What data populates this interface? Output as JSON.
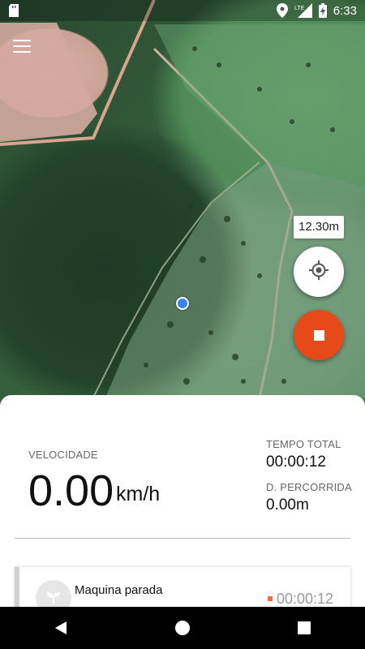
{
  "status_bar": {
    "network": "LTE",
    "time": "6:33"
  },
  "map": {
    "accuracy_label": "12.30m"
  },
  "stats": {
    "speed_label": "VELOCIDADE",
    "speed_value": "0.00",
    "speed_unit": "km/h",
    "total_time_label": "TEMPO TOTAL",
    "total_time_value": "00:00:12",
    "distance_label": "D. PERCORRIDA",
    "distance_value": "0.00m"
  },
  "events": [
    {
      "title": "Maquina parada",
      "time": "00:00:12"
    }
  ],
  "icons": {
    "sd_card": "sd-card-icon",
    "location": "location-icon",
    "signal": "signal-icon",
    "battery": "battery-charging-icon",
    "menu": "menu-icon",
    "locate": "gps-fixed-icon",
    "stop": "stop-icon",
    "plant": "sprout-icon",
    "back": "back-triangle-icon",
    "home": "home-circle-icon",
    "recents": "recents-square-icon"
  },
  "colors": {
    "stop_fab": "#e64a19",
    "position_dot": "#3b82f6",
    "event_marker": "#f46a3a"
  }
}
